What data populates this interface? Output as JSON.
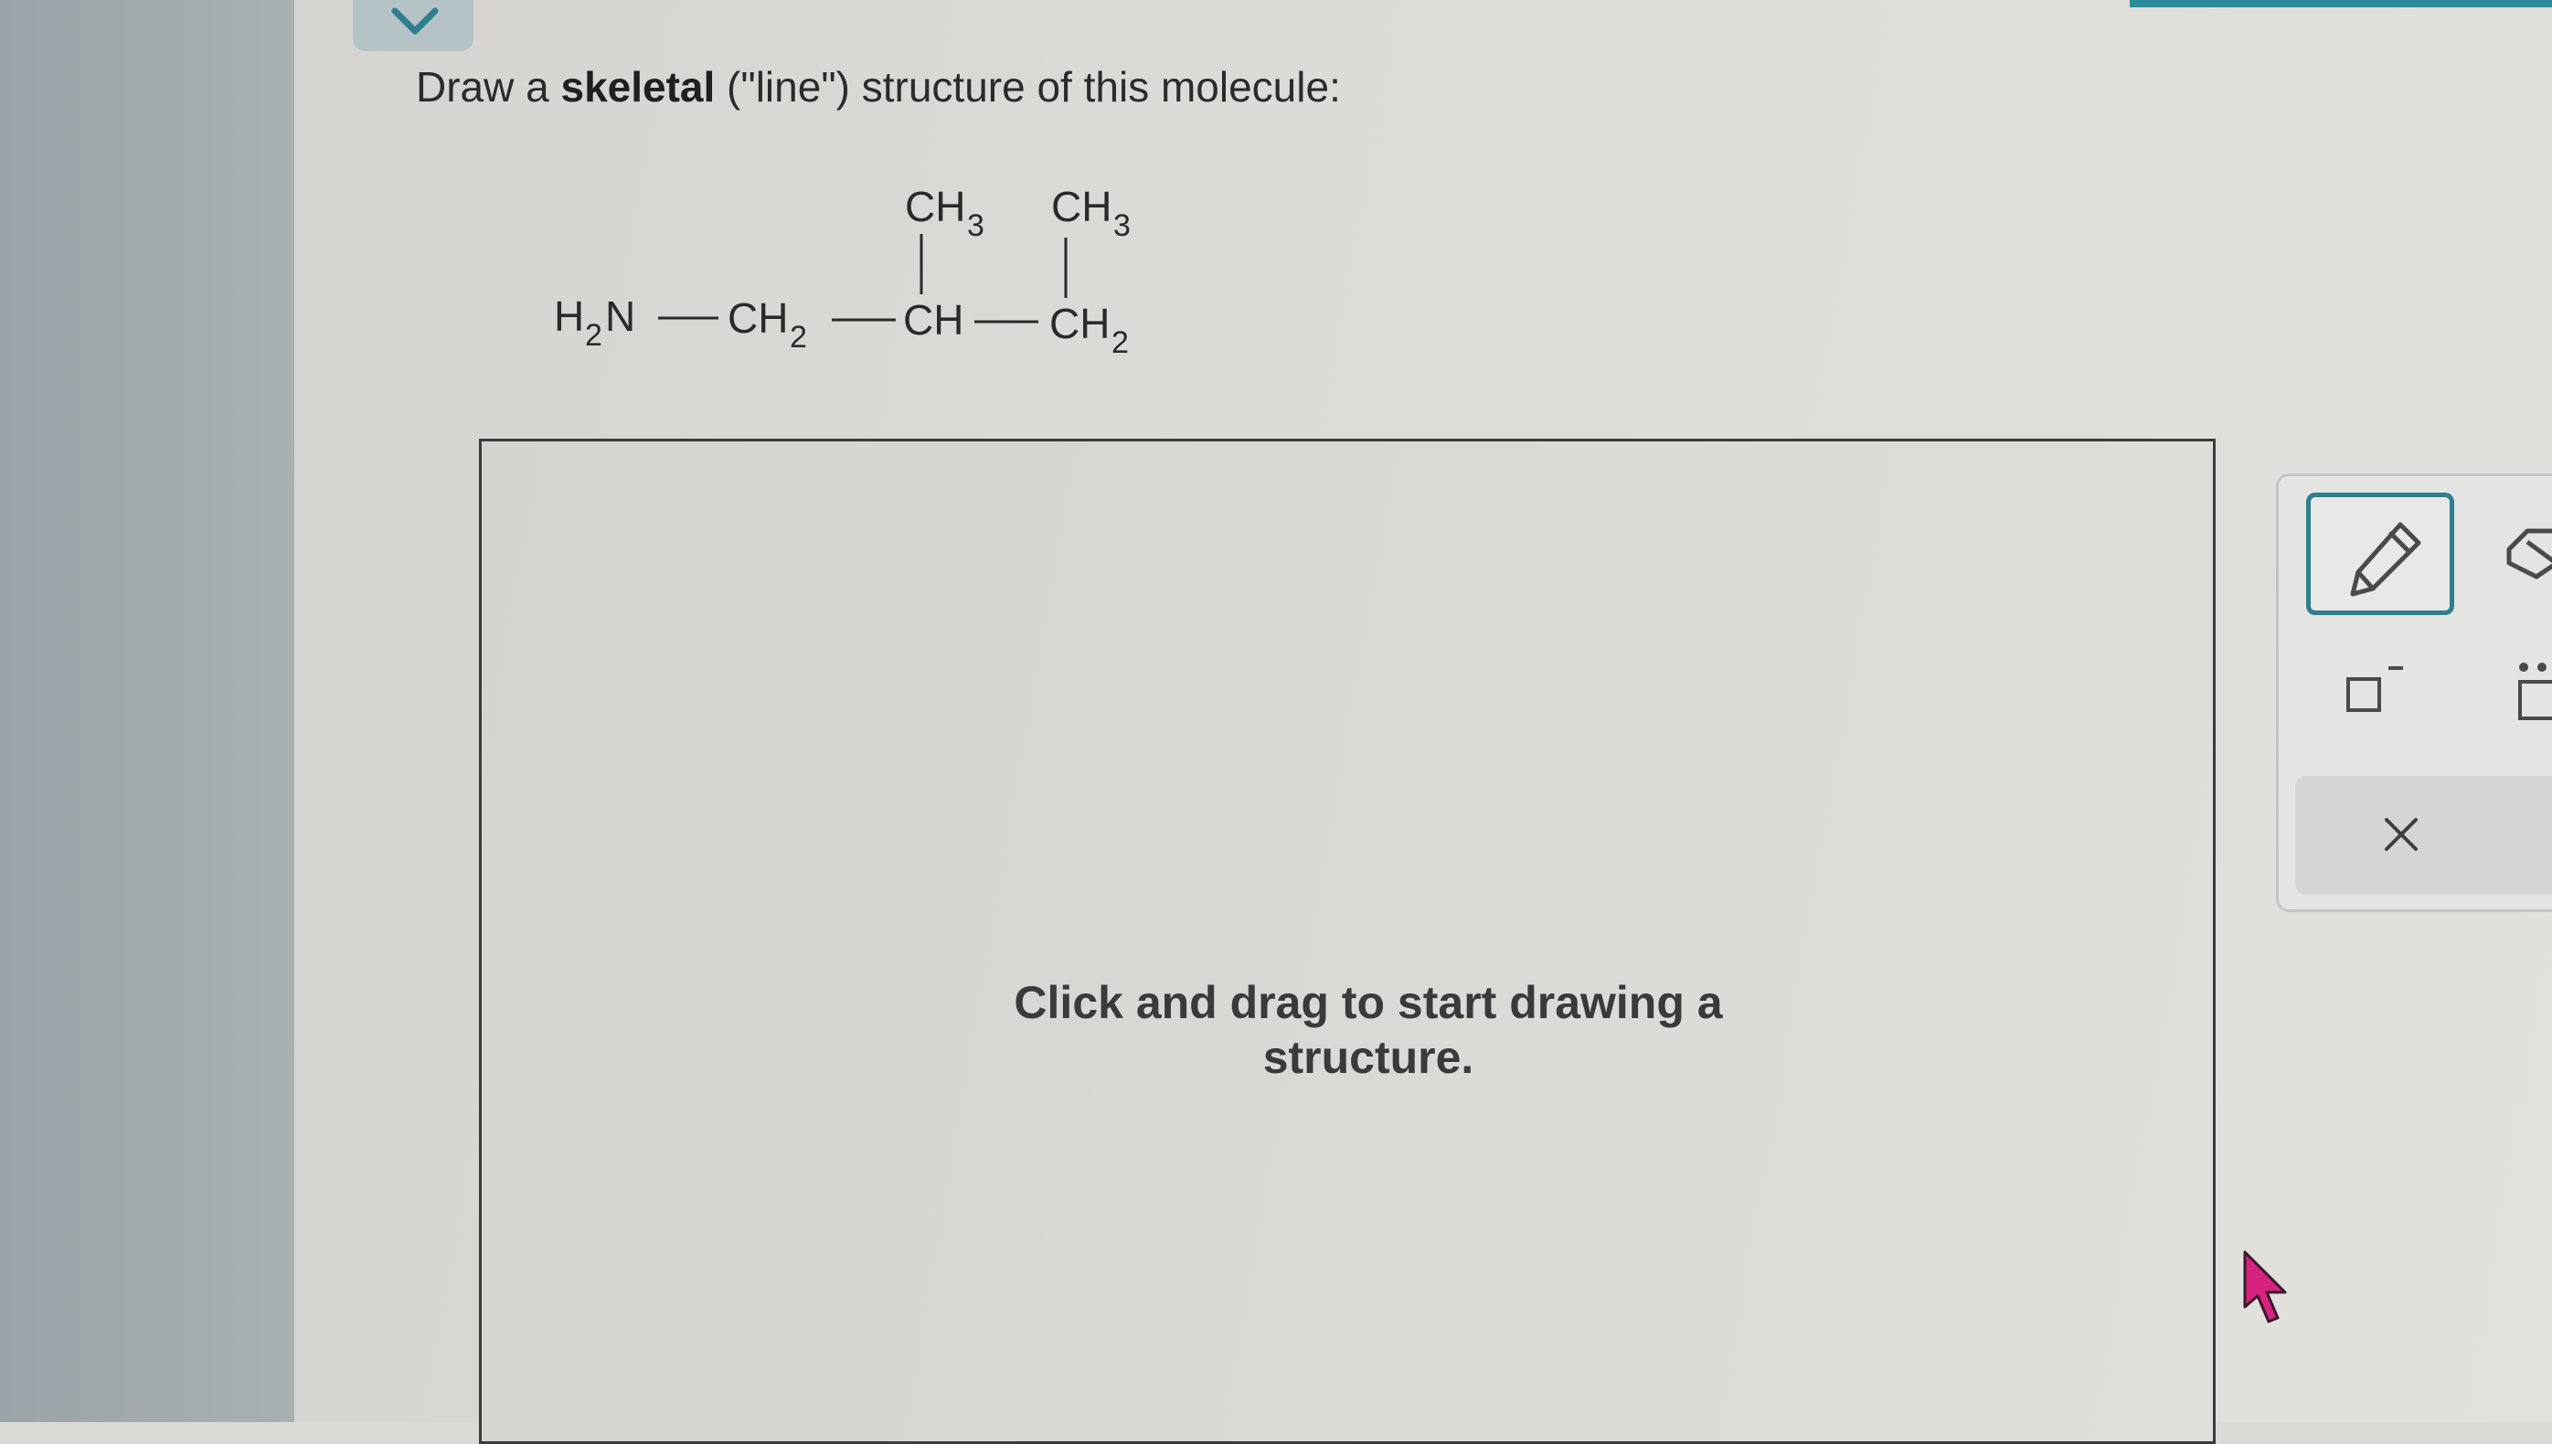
{
  "prompt": {
    "before": "Draw a ",
    "bold": "skeletal",
    "after": " (\"line\") structure of this molecule:"
  },
  "molecule": {
    "main_chain": [
      "H2N",
      "CH2",
      "CH",
      "CH2"
    ],
    "branches": [
      {
        "label": "CH3",
        "attached_to": "CH"
      },
      {
        "label": "CH3",
        "attached_to": "CH2"
      }
    ],
    "text": {
      "h": "H",
      "n": "N",
      "c": "C",
      "sub2": "2",
      "sub3": "3"
    }
  },
  "canvas": {
    "hint": "Click and drag to start drawing a structure."
  },
  "toolbar": {
    "tools": [
      "pencil-icon",
      "eraser-icon",
      "charge-icon",
      "lone-pair-icon",
      "close-icon"
    ],
    "accent_color": "#2f7e8e"
  },
  "colors": {
    "top_accent": "#2a8c9a",
    "cursor": "#d6237f"
  }
}
